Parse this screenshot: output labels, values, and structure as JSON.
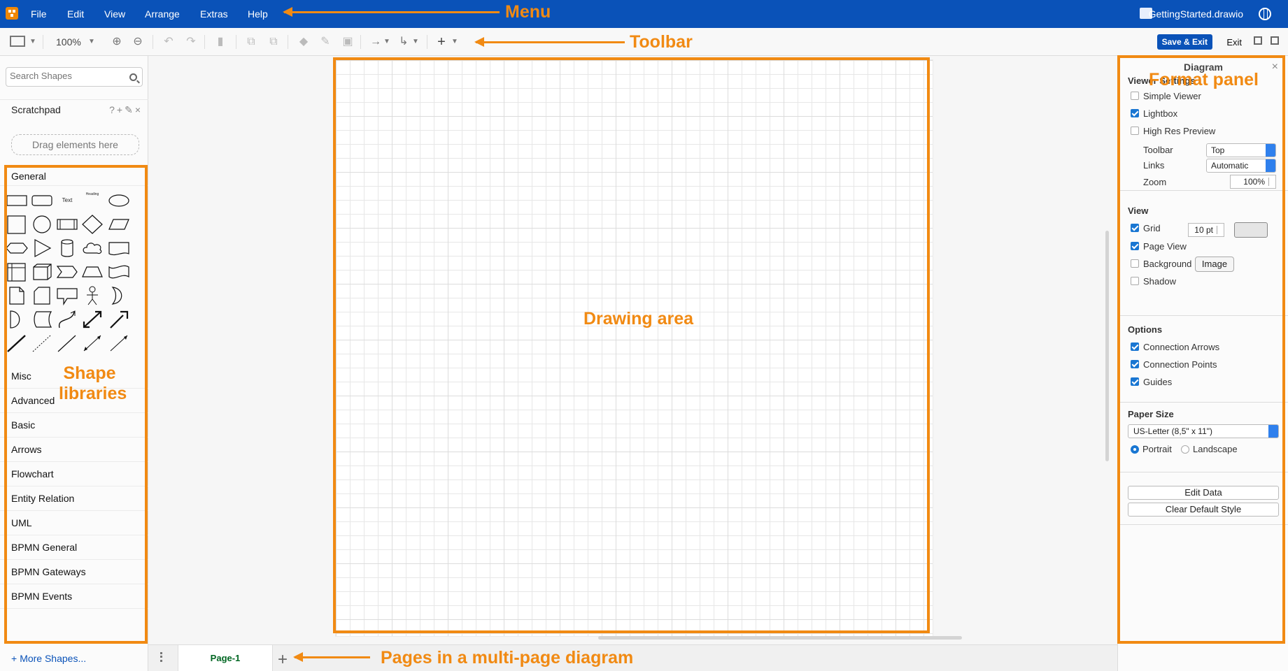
{
  "menu": {
    "items": [
      "File",
      "Edit",
      "View",
      "Arrange",
      "Extras",
      "Help"
    ],
    "file_title": "GettingStarted.drawio"
  },
  "toolbar": {
    "zoom": "100%",
    "save_exit": "Save & Exit",
    "exit": "Exit"
  },
  "sidebar": {
    "search_placeholder": "Search Shapes",
    "scratchpad": "Scratchpad",
    "scratchpad_tools": "?+✎×",
    "drag_text": "Drag elements here",
    "libraries": [
      "General",
      "Misc",
      "Advanced",
      "Basic",
      "Arrows",
      "Flowchart",
      "Entity Relation",
      "UML",
      "BPMN General",
      "BPMN Gateways",
      "BPMN Events"
    ],
    "more_shapes": "More Shapes...",
    "text_shape": "Text",
    "heading_shape": "Heading"
  },
  "pages": {
    "tab": "Page-1"
  },
  "format_panel": {
    "title": "Diagram",
    "viewer_settings": {
      "title": "Viewer Settings",
      "simple_viewer": "Simple Viewer",
      "lightbox": "Lightbox",
      "high_res": "High Res Preview",
      "toolbar_label": "Toolbar",
      "toolbar_value": "Top",
      "links_label": "Links",
      "links_value": "Automatic",
      "zoom_label": "Zoom",
      "zoom_value": "100%"
    },
    "view": {
      "title": "View",
      "grid": "Grid",
      "grid_size": "10 pt",
      "page_view": "Page View",
      "background": "Background",
      "image_button": "Image",
      "shadow": "Shadow"
    },
    "options": {
      "title": "Options",
      "connection_arrows": "Connection Arrows",
      "connection_points": "Connection Points",
      "guides": "Guides"
    },
    "paper": {
      "title": "Paper Size",
      "value": "US-Letter (8,5\" x 11\")",
      "portrait": "Portrait",
      "landscape": "Landscape"
    },
    "edit_data": "Edit Data",
    "clear_style": "Clear Default Style"
  },
  "annotations": {
    "menu": "Menu",
    "toolbar": "Toolbar",
    "format_panel": "Format panel",
    "drawing_area": "Drawing area",
    "shape_libraries": "Shape libraries",
    "pages": "Pages in a multi-page diagram"
  },
  "colors": {
    "brand": "#0a52b8",
    "annotation": "#f18a13",
    "page_tab_text": "#006622"
  }
}
